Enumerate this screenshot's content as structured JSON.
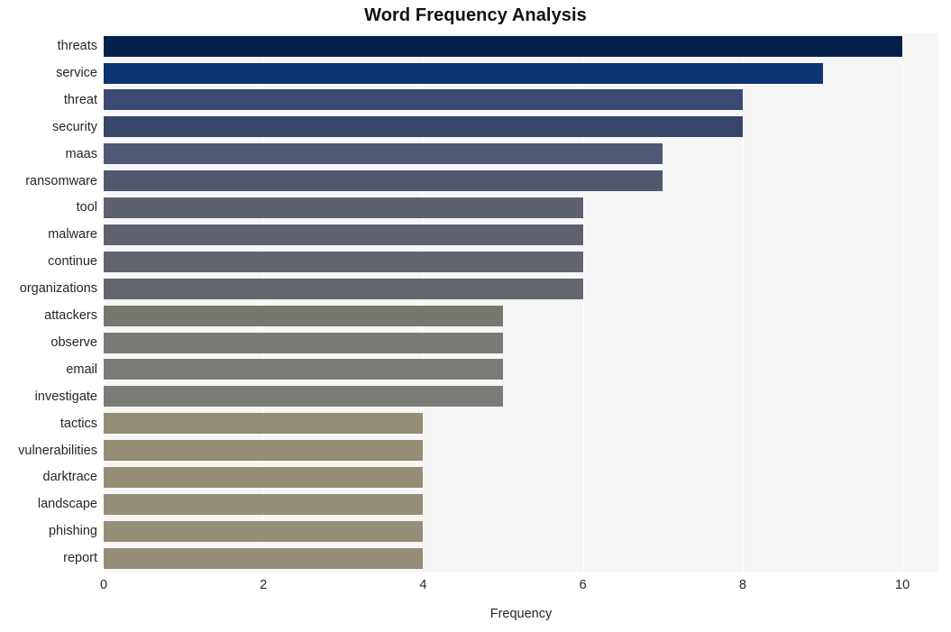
{
  "chart_data": {
    "type": "bar",
    "orientation": "horizontal",
    "title": "Word Frequency Analysis",
    "xlabel": "Frequency",
    "ylabel": "",
    "xlim": [
      0,
      10.45
    ],
    "xticks": [
      0,
      2,
      4,
      6,
      8,
      10
    ],
    "xtick_labels": [
      "0",
      "2",
      "4",
      "6",
      "8",
      "10"
    ],
    "grid": "vertical-white-on-light-gray",
    "legend": "none",
    "categories": [
      "threats",
      "service",
      "threat",
      "security",
      "maas",
      "ransomware",
      "tool",
      "malware",
      "continue",
      "organizations",
      "attackers",
      "observe",
      "email",
      "investigate",
      "tactics",
      "vulnerabilities",
      "darktrace",
      "landscape",
      "phishing",
      "report"
    ],
    "values": [
      10,
      9,
      8,
      8,
      7,
      7,
      6,
      6,
      6,
      6,
      5,
      5,
      5,
      5,
      4,
      4,
      4,
      4,
      4,
      4
    ],
    "bar_colors": [
      "#04214b",
      "#0d3372",
      "#3a4a73",
      "#374669",
      "#515873",
      "#51576e",
      "#5d616d",
      "#5f626d",
      "#62656e",
      "#64666e",
      "#77776f",
      "#7a7a76",
      "#7b7b77",
      "#7b7b77",
      "#938d74",
      "#948e76",
      "#948e76",
      "#948e76",
      "#948e76",
      "#948e76"
    ],
    "plot_background": "#f6f6f7",
    "gridline_color": "#ffffff",
    "text_color": "#262626"
  }
}
